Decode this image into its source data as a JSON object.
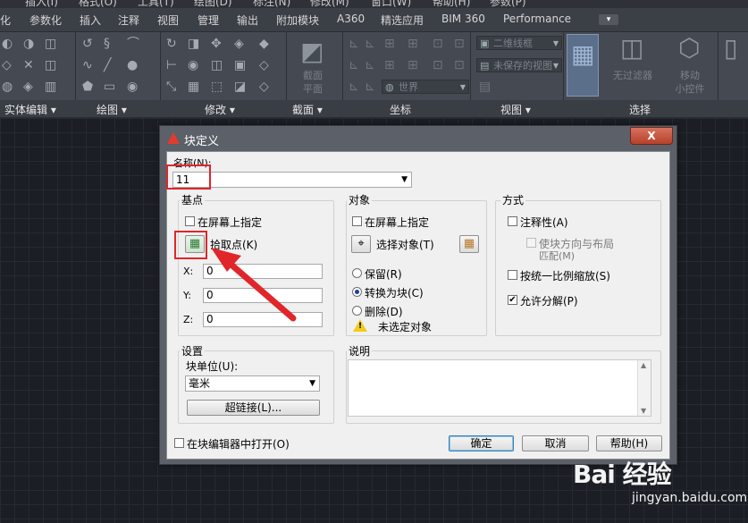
{
  "menubar": [
    "插入(I)",
    "格式(O)",
    "工具(T)",
    "绘图(D)",
    "标注(N)",
    "修改(M)",
    "窗口(W)",
    "帮助(H)",
    "参数(P)"
  ],
  "tabs": [
    "化",
    "参数化",
    "插入",
    "注释",
    "视图",
    "管理",
    "输出",
    "附加模块",
    "A360",
    "精选应用",
    "BIM 360",
    "Performance"
  ],
  "ribbon": {
    "panels": [
      "实体编辑 ▾",
      "绘图 ▾",
      "修改 ▾",
      "截面 ▾",
      "坐标",
      "视图 ▾",
      "选择"
    ],
    "section_plane_label": [
      "截面",
      "平面"
    ],
    "ucs_combo": "世界",
    "visual_style_combo": "二维线框",
    "view_combo": "未保存的视图",
    "filter_label": "无过滤器",
    "gizmo_label": [
      "移动",
      "小控件"
    ]
  },
  "dialog": {
    "title": "块定义",
    "close": "X",
    "name": {
      "label": "名称(N):",
      "value": "11"
    },
    "base_point": {
      "title": "基点",
      "specify_on_screen": "在屏幕上指定",
      "pick_point": "拾取点(K)",
      "x_label": "X:",
      "x_value": "0",
      "y_label": "Y:",
      "y_value": "0",
      "z_label": "Z:",
      "z_value": "0"
    },
    "objects": {
      "title": "对象",
      "specify_on_screen": "在屏幕上指定",
      "select_objects": "选择对象(T)",
      "retain": "保留(R)",
      "convert_to_block": "转换为块(C)",
      "delete": "删除(D)",
      "status": "未选定对象",
      "selected_option": "convert_to_block"
    },
    "behavior": {
      "title": "方式",
      "annotative": "注释性(A)",
      "match_orientation_1": "使块方向与布局",
      "match_orientation_2": "匹配(M)",
      "scale_uniformly": "按统一比例缩放(S)",
      "allow_exploding": "允许分解(P)",
      "allow_exploding_checked": true
    },
    "settings": {
      "title": "设置",
      "block_unit_label": "块单位(U):",
      "block_unit_value": "毫米",
      "hyperlink": "超链接(L)..."
    },
    "description": {
      "title": "说明",
      "value": ""
    },
    "open_in_editor": "在块编辑器中打开(O)",
    "ok": "确定",
    "cancel": "取消",
    "help": "帮助(H)"
  },
  "watermark": {
    "logo": "Bai 经验",
    "url": "jingyan.baidu.com"
  },
  "colors": {
    "highlight": "#e0262a",
    "canvas": "#1b1e24",
    "ribbon": "#454a52"
  }
}
